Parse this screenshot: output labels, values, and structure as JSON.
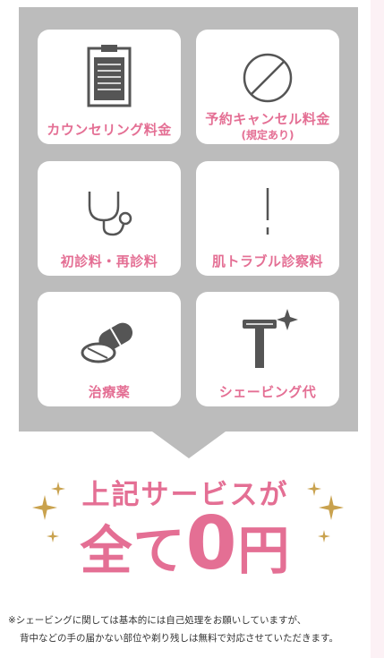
{
  "services": [
    {
      "label": "カウンセリング料金",
      "sublabel": "",
      "icon": "clipboard-icon"
    },
    {
      "label": "予約キャンセル料金",
      "sublabel": "(規定あり)",
      "icon": "prohibited-icon"
    },
    {
      "label": "初診料・再診料",
      "sublabel": "",
      "icon": "stethoscope-icon"
    },
    {
      "label": "肌トラブル診察料",
      "sublabel": "",
      "icon": "exclamation-icon"
    },
    {
      "label": "治療薬",
      "sublabel": "",
      "icon": "pills-icon"
    },
    {
      "label": "シェービング代",
      "sublabel": "",
      "icon": "razor-icon"
    }
  ],
  "headline": {
    "line1": "上記サービスが",
    "line2_prefix": "全て",
    "line2_number": "0",
    "line2_suffix": "円"
  },
  "note": {
    "line1": "※シェービングに関しては基本的には自己処理をお願いしていますが、",
    "line2": "背中などの手の届かない部位や剃り残しは無料で対応させていただきます。"
  },
  "colors": {
    "accent": "#e46f94",
    "panel": "#bcbcbc",
    "icon": "#555555",
    "sparkle": "#c9a24e",
    "side_strip": "#fcf1f5"
  }
}
